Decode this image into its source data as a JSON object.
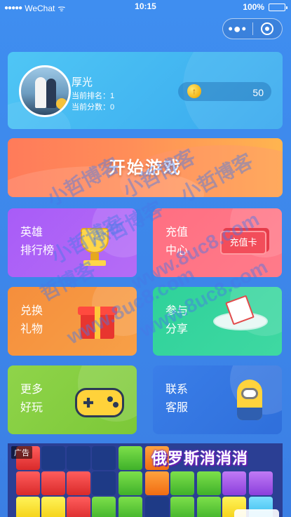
{
  "status_bar": {
    "signal": "●●●●●",
    "carrier": "WeChat",
    "wifi": "ᯤ",
    "time": "10:15",
    "battery": "100%"
  },
  "capsule": {
    "more_label": "•●•"
  },
  "profile": {
    "name": "厚光",
    "rank_text": "当前排名：1",
    "score_text": "当前分数：0",
    "coins": "50",
    "coin_glyph": "↑"
  },
  "start": {
    "label": "开始游戏"
  },
  "tiles": [
    {
      "line1": "英雄",
      "line2": "排行榜"
    },
    {
      "line1": "充值",
      "line2": "中心",
      "badge": "充值卡"
    },
    {
      "line1": "兑换",
      "line2": "礼物"
    },
    {
      "line1": "参与",
      "line2": "分享"
    },
    {
      "line1": "更多",
      "line2": "好玩"
    },
    {
      "line1": "联系",
      "line2": "客服"
    }
  ],
  "ad": {
    "tag": "广告",
    "title": "俄罗斯消消消"
  },
  "watermarks": [
    "小哲博客",
    "小哲博客",
    "小哲博客",
    "小哲博客",
    "www.8uc8.com",
    "哲博客",
    "小哲博客",
    "www.8uc8.com",
    "www.8uc8.com"
  ],
  "colors": {
    "background": "#3f8ef0",
    "profile_card": "#4fc6f5",
    "start_banner": "#ff8e58",
    "hero_tile": "#a85cf7",
    "charge_tile": "#ff6f82",
    "gift_tile": "#f58e3c",
    "share_tile": "#2fd29a",
    "more_tile": "#8fd44a",
    "contact_tile": "#3a7ee8",
    "coin": "#f2b516"
  },
  "icons": [
    "signal-dots-icon",
    "wifi-icon",
    "battery-icon",
    "more-dots-icon",
    "close-target-icon",
    "coin-icon",
    "trophy-icon",
    "charge-card-icon",
    "gift-box-icon",
    "share-plate-icon",
    "gamepad-icon",
    "minion-icon"
  ]
}
